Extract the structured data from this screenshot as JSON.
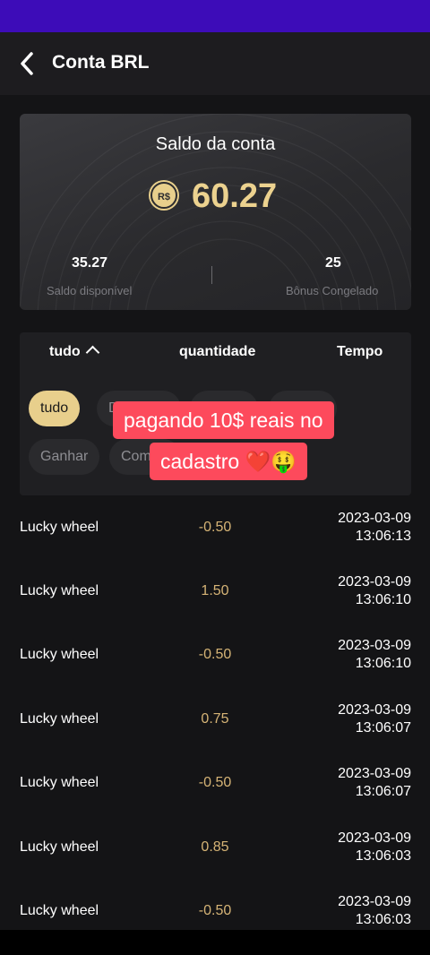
{
  "header": {
    "title": "Conta BRL",
    "back_icon": "chevron-left-icon"
  },
  "balance": {
    "title": "Saldo da conta",
    "currency_symbol": "R$",
    "total": "60.27",
    "available_value": "35.27",
    "available_label": "Saldo disponível",
    "frozen_value": "25",
    "frozen_label": "Bônus Congelado"
  },
  "filters": {
    "headers": [
      "tudo",
      "quantidade",
      "Tempo"
    ],
    "chips": [
      "tudo",
      "D",
      "",
      "",
      "Ganhar",
      "Com"
    ],
    "active_chip": "tudo"
  },
  "overlay": {
    "line1": "pagando 10$ reais no",
    "line2": "cadastro ❤️🤑"
  },
  "transactions": [
    {
      "name": "Lucky wheel",
      "amount": "-0.50",
      "date": "2023-03-09",
      "time": "13:06:13"
    },
    {
      "name": "Lucky wheel",
      "amount": "1.50",
      "date": "2023-03-09",
      "time": "13:06:10"
    },
    {
      "name": "Lucky wheel",
      "amount": "-0.50",
      "date": "2023-03-09",
      "time": "13:06:10"
    },
    {
      "name": "Lucky wheel",
      "amount": "0.75",
      "date": "2023-03-09",
      "time": "13:06:07"
    },
    {
      "name": "Lucky wheel",
      "amount": "-0.50",
      "date": "2023-03-09",
      "time": "13:06:07"
    },
    {
      "name": "Lucky wheel",
      "amount": "0.85",
      "date": "2023-03-09",
      "time": "13:06:03"
    },
    {
      "name": "Lucky wheel",
      "amount": "-0.50",
      "date": "2023-03-09",
      "time": "13:06:03"
    }
  ],
  "colors": {
    "accent_gold": "#e8cf8c",
    "amount_gold": "#d6b476",
    "status_bar": "#3d0cb8",
    "overlay_red": "#fd4a5c"
  }
}
